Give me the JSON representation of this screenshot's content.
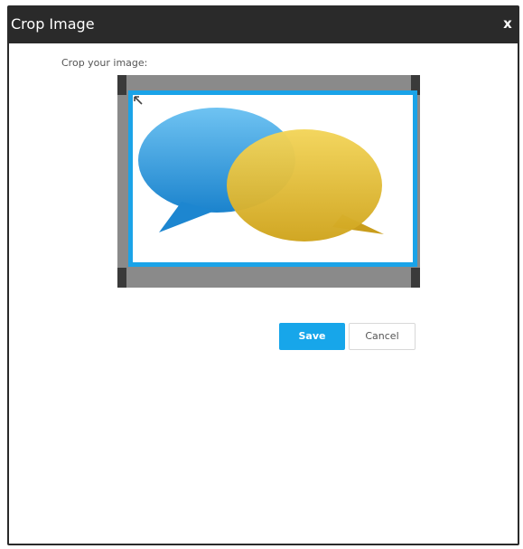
{
  "dialog": {
    "title": "Crop Image",
    "close_label": "x",
    "prompt": "Crop your image:"
  },
  "actions": {
    "save_label": "Save",
    "cancel_label": "Cancel"
  },
  "icons": {
    "close": "close-icon",
    "image": "chat-bubbles-image",
    "resize_handle": "resize-handle-icon"
  },
  "colors": {
    "titlebar": "#2a2a2a",
    "accent": "#1aa3e8",
    "crop_background": "#8a8a8a",
    "blue_bubble": "#2f9ddf",
    "yellow_bubble": "#e2bc2d"
  }
}
